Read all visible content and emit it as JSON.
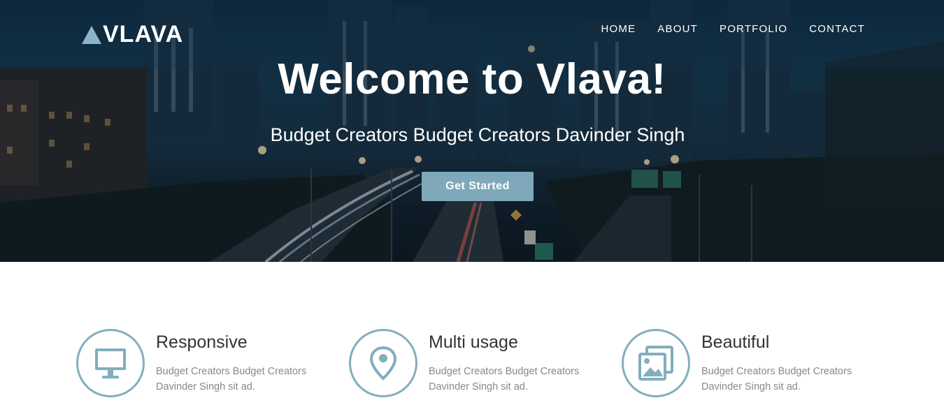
{
  "brand": {
    "name": "VLAVA",
    "accent": "#82aebe"
  },
  "nav": {
    "items": [
      {
        "label": "HOME"
      },
      {
        "label": "ABOUT"
      },
      {
        "label": "PORTFOLIO"
      },
      {
        "label": "CONTACT"
      }
    ]
  },
  "hero": {
    "headline": "Welcome to Vlava!",
    "subhead": "Budget Creators Budget Creators Davinder Singh",
    "cta_label": "Get Started",
    "background": "night-city-highway-photo"
  },
  "features": [
    {
      "icon": "monitor-icon",
      "title": "Responsive",
      "text": "Budget Creators Budget Creators Davinder Singh sit ad."
    },
    {
      "icon": "map-pin-icon",
      "title": "Multi usage",
      "text": "Budget Creators Budget Creators Davinder Singh sit ad."
    },
    {
      "icon": "image-gallery-icon",
      "title": "Beautiful",
      "text": "Budget Creators Budget Creators Davinder Singh sit ad."
    }
  ]
}
